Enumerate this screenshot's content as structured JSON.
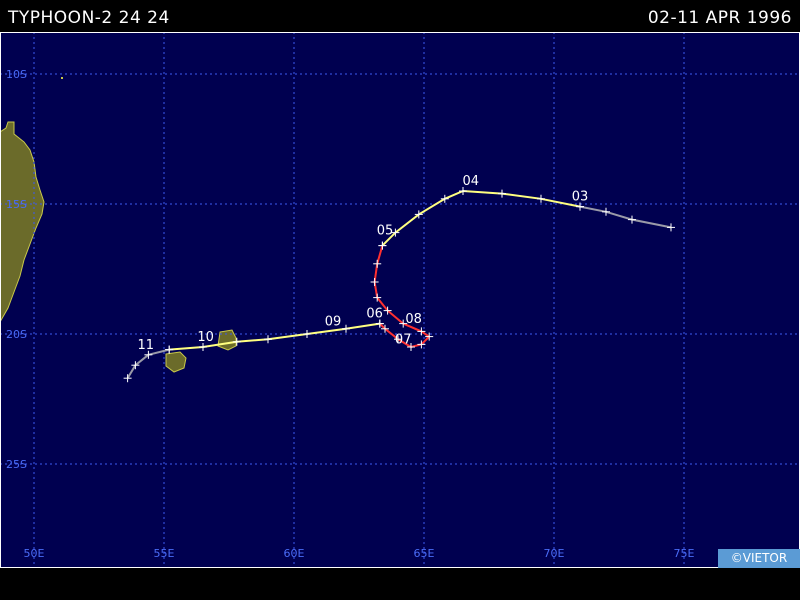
{
  "header": {
    "title": "TYPHOON-2 24 24",
    "dates": "02-11 APR 1996"
  },
  "credit": "©VIETOR",
  "colors": {
    "ocean": "#000050",
    "grid": "#3d5af1",
    "land": "#6b6b2a",
    "land_outline": "#c8c84a",
    "track_yellow": "#ffff80",
    "track_red": "#ff3030",
    "track_gray": "#9a9aa8",
    "tick": "#ffffff"
  },
  "map": {
    "lon_range": [
      50,
      80
    ],
    "lat_range": [
      -28,
      -8
    ],
    "lon_ticks": [
      50,
      55,
      60,
      65,
      70,
      75
    ],
    "lon_labels": [
      "50E",
      "55E",
      "60E",
      "65E",
      "70E",
      "75E"
    ],
    "lat_ticks": [
      -10,
      -15,
      -20,
      -25
    ],
    "lat_labels": [
      "10S",
      "15S",
      "20S",
      "25S"
    ]
  },
  "track": {
    "segments": [
      {
        "color": "gray",
        "points": [
          [
            74.5,
            -15.9
          ],
          [
            73.0,
            -15.6
          ],
          [
            72.0,
            -15.3
          ],
          [
            71.0,
            -15.1
          ]
        ]
      },
      {
        "color": "yellow",
        "points": [
          [
            71.0,
            -15.1
          ],
          [
            69.5,
            -14.8
          ],
          [
            68.0,
            -14.6
          ],
          [
            66.5,
            -14.5
          ],
          [
            65.8,
            -14.8
          ],
          [
            64.8,
            -15.4
          ],
          [
            63.9,
            -16.1
          ],
          [
            63.4,
            -16.6
          ]
        ]
      },
      {
        "color": "red",
        "points": [
          [
            63.4,
            -16.6
          ],
          [
            63.2,
            -17.3
          ],
          [
            63.1,
            -18.0
          ],
          [
            63.2,
            -18.6
          ],
          [
            63.6,
            -19.1
          ],
          [
            64.2,
            -19.6
          ],
          [
            64.9,
            -19.9
          ],
          [
            65.2,
            -20.1
          ],
          [
            64.9,
            -20.4
          ],
          [
            64.5,
            -20.5
          ],
          [
            64.0,
            -20.2
          ],
          [
            63.5,
            -19.8
          ],
          [
            63.3,
            -19.6
          ]
        ]
      },
      {
        "color": "yellow",
        "points": [
          [
            63.3,
            -19.6
          ],
          [
            62.0,
            -19.8
          ],
          [
            60.5,
            -20.0
          ],
          [
            59.0,
            -20.2
          ],
          [
            57.8,
            -20.3
          ],
          [
            56.5,
            -20.5
          ],
          [
            55.2,
            -20.6
          ]
        ]
      },
      {
        "color": "gray",
        "points": [
          [
            55.2,
            -20.6
          ],
          [
            54.4,
            -20.8
          ],
          [
            53.9,
            -21.2
          ],
          [
            53.6,
            -21.7
          ]
        ]
      }
    ],
    "day_labels": [
      {
        "text": "03",
        "lon": 71.0,
        "lat": -15.1
      },
      {
        "text": "04",
        "lon": 66.8,
        "lat": -14.5
      },
      {
        "text": "05",
        "lon": 63.5,
        "lat": -16.4
      },
      {
        "text": "06",
        "lon": 63.1,
        "lat": -19.6
      },
      {
        "text": "07",
        "lon": 64.2,
        "lat": -20.6
      },
      {
        "text": "08",
        "lon": 64.6,
        "lat": -19.8
      },
      {
        "text": "09",
        "lon": 61.5,
        "lat": -19.9
      },
      {
        "text": "10",
        "lon": 56.6,
        "lat": -20.5
      },
      {
        "text": "11",
        "lon": 54.3,
        "lat": -20.8
      }
    ]
  }
}
